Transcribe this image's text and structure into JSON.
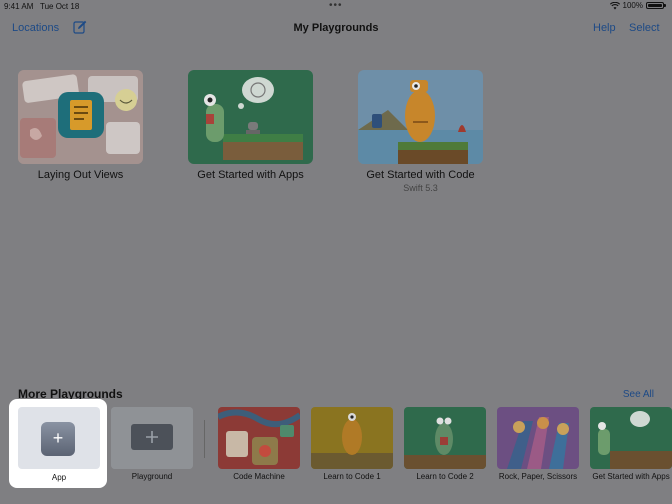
{
  "status_bar": {
    "time": "9:41 AM",
    "date": "Tue Oct 18",
    "battery": "100%"
  },
  "nav": {
    "locations": "Locations",
    "title": "My Playgrounds",
    "help": "Help",
    "select": "Select"
  },
  "playgrounds": [
    {
      "title": "Laying Out Views",
      "subtitle": ""
    },
    {
      "title": "Get Started with Apps",
      "subtitle": ""
    },
    {
      "title": "Get Started with Code",
      "subtitle": "Swift 5.3"
    }
  ],
  "more": {
    "title": "More Playgrounds",
    "see_all": "See All",
    "templates": [
      {
        "label": "App",
        "icon": "plus-icon"
      },
      {
        "label": "Playground",
        "icon": "plus-icon"
      }
    ],
    "items": [
      {
        "label": "Code Machine"
      },
      {
        "label": "Learn to Code 1"
      },
      {
        "label": "Learn to Code 2"
      },
      {
        "label": "Rock, Paper, Scissors"
      },
      {
        "label": "Get Started with Apps"
      }
    ]
  },
  "colors": {
    "accent": "#1d4a86",
    "dim_overlay": "#7f7f82"
  }
}
